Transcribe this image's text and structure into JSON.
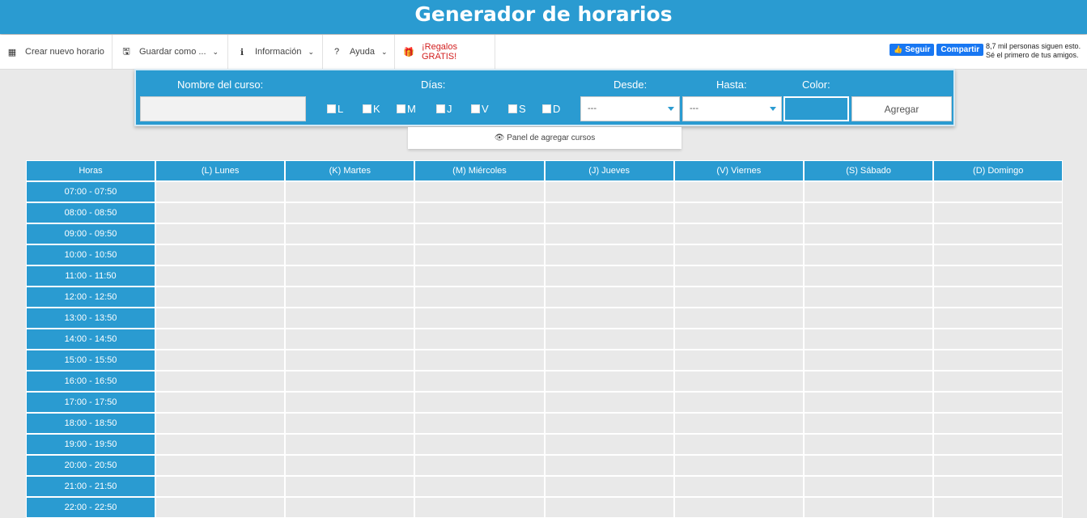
{
  "app": {
    "title": "Generador de horarios"
  },
  "toolbar": {
    "new_schedule": "Crear nuevo horario",
    "save_as": "Guardar como ...",
    "info": "Información",
    "help": "Ayuda",
    "gifts": "¡Regalos GRATIS!"
  },
  "facebook": {
    "follow": "Seguir",
    "share": "Compartir",
    "line1": "8,7 mil personas siguen esto.",
    "line2": "Sé el primero de tus amigos."
  },
  "panel": {
    "course_label": "Nombre del curso:",
    "days_label": "Días:",
    "days": [
      "L",
      "K",
      "M",
      "J",
      "V",
      "S",
      "D"
    ],
    "from_label": "Desde:",
    "to_label": "Hasta:",
    "color_label": "Color:",
    "from_value": "---",
    "to_value": "---",
    "add_button": "Agregar",
    "color_value": "#2a9bd1",
    "toggle_label": "Panel de agregar cursos"
  },
  "schedule": {
    "headers": [
      "Horas",
      "(L) Lunes",
      "(K) Martes",
      "(M) Miércoles",
      "(J) Jueves",
      "(V) Viernes",
      "(S) Sábado",
      "(D) Domingo"
    ],
    "hours": [
      "07:00 - 07:50",
      "08:00 - 08:50",
      "09:00 - 09:50",
      "10:00 - 10:50",
      "11:00 - 11:50",
      "12:00 - 12:50",
      "13:00 - 13:50",
      "14:00 - 14:50",
      "15:00 - 15:50",
      "16:00 - 16:50",
      "17:00 - 17:50",
      "18:00 - 18:50",
      "19:00 - 19:50",
      "20:00 - 20:50",
      "21:00 - 21:50",
      "22:00 - 22:50"
    ]
  },
  "colors": {
    "accent": "#2a9bd1",
    "background": "#e9e9e9",
    "facebook": "#1877f2",
    "gift_red": "#d21e1e"
  }
}
